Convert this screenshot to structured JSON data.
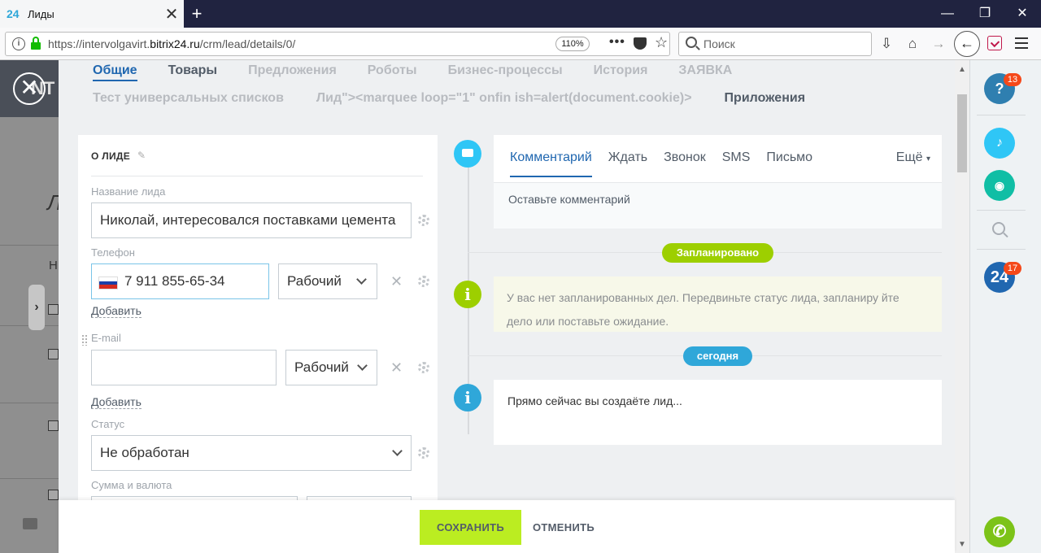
{
  "browser": {
    "tab_favicon": "24",
    "tab_title": "Лиды",
    "tab_close": "✕",
    "new_tab": "+",
    "url_prefix": "https://intervolgavirt.",
    "url_domain": "bitrix24.ru",
    "url_path": "/crm/lead/details/0/",
    "zoom": "110%",
    "search_placeholder": "Поиск",
    "window_controls": [
      "—",
      "❐",
      "✕"
    ]
  },
  "background_page": {
    "letter_1": "Л",
    "letter_2": "Н",
    "logo_fragment": "NT"
  },
  "slider": {
    "tabs_row1": [
      "Общие",
      "Товары",
      "Предложения",
      "Роботы",
      "Бизнес-процессы",
      "История",
      "ЗАЯВКА"
    ],
    "tabs_row2": [
      "Тест универсальных списков",
      "Лид\"><marquee loop=\"1\" onfin ish=alert(document.cookie)>",
      "Приложения"
    ],
    "lead_card": {
      "title": "О ЛИДЕ",
      "name_label": "Название лида",
      "name_value": "Николай, интересовался поставками цемента",
      "phone_label": "Телефон",
      "phone_value": "7 911 855-65-34",
      "phone_type": "Рабочий",
      "add_label": "Добавить",
      "email_label": "E-mail",
      "email_value": "",
      "email_type": "Рабочий",
      "status_label": "Статус",
      "status_value": "Не обработан",
      "sum_label": "Сумма и валюта"
    },
    "timeline": {
      "comment_tabs": [
        "Комментарий",
        "Ждать",
        "Звонок",
        "SMS",
        "Письмо"
      ],
      "more_tab": "Ещё",
      "comment_placeholder": "Оставьте комментарий",
      "planned_badge": "Запланировано",
      "planned_text": "У вас нет запланированных дел. Передвиньте статус лида, запланиру йте дело или поставьте ожидание.",
      "today_badge": "сегодня",
      "creating_text": "Прямо сейчас вы создаёте лид..."
    }
  },
  "footer": {
    "save_label": "СОХРАНИТЬ",
    "cancel_label": "ОТМЕНИТЬ"
  },
  "rightbar": {
    "help_badge": "13",
    "bitrix_label": "24",
    "bitrix_badge": "17"
  },
  "colors": {
    "accent_blue": "#2067b0",
    "save_green": "#bbed21",
    "timeline_cyan": "#2fc6f6",
    "timeline_green": "#9dcf00",
    "badge_red": "#f54819"
  },
  "icons": [
    "info-icon",
    "lock-icon",
    "pocket-icon",
    "star-icon",
    "search-icon",
    "download-icon",
    "home-icon",
    "forward-icon",
    "back-icon",
    "menu-icon",
    "close-icon",
    "pencil-icon",
    "gear-icon",
    "chevron-down-icon",
    "russia-flag-icon",
    "chat-icon",
    "info-timeline-icon",
    "help-icon",
    "bell-icon",
    "chat-widget-icon",
    "phone-icon",
    "printer-icon"
  ]
}
